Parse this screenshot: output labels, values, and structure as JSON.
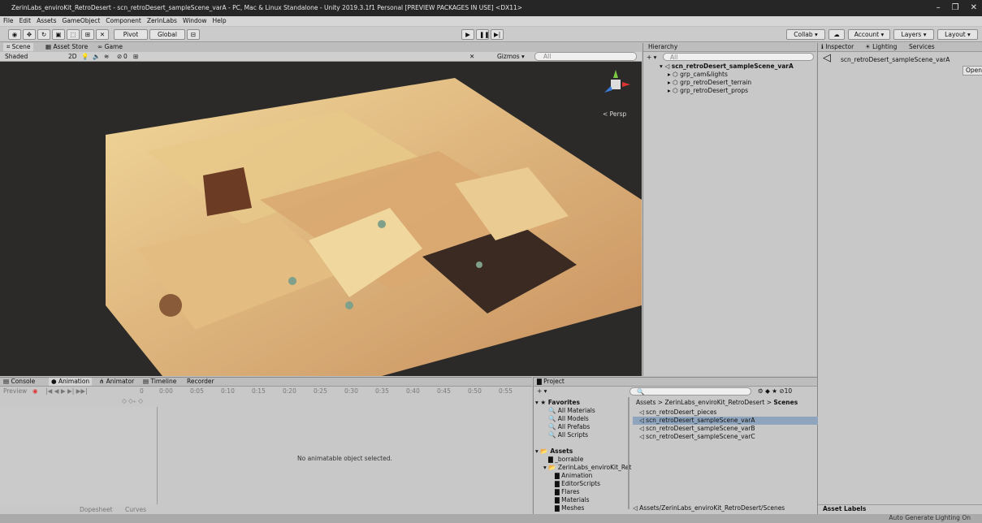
{
  "window": {
    "title": "ZerinLabs_enviroKit_RetroDesert - scn_retroDesert_sampleScene_varA - PC, Mac & Linux Standalone - Unity 2019.3.1f1 Personal [PREVIEW PACKAGES IN USE] <DX11>"
  },
  "menu": [
    "File",
    "Edit",
    "Assets",
    "GameObject",
    "Component",
    "ZerinLabs",
    "Window",
    "Help"
  ],
  "toolbar": {
    "pivot": "Pivot",
    "global": "Global",
    "collab": "Collab ▾",
    "account": "Account ▾",
    "layers": "Layers ▾",
    "layout": "Layout ▾"
  },
  "scene": {
    "tab_scene": "Scene",
    "tab_store": "Asset Store",
    "tab_game": "Game",
    "shading": "Shaded",
    "mode2d": "2D",
    "gizmos": "Gizmos ▾",
    "search": "All",
    "persp": "< Persp",
    "fx_count": "0"
  },
  "hierarchy": {
    "title": "Hierarchy",
    "search": "All",
    "root": "scn_retroDesert_sampleScene_varA",
    "items": [
      "grp_cam&lights",
      "grp_retroDesert_terrain",
      "grp_retroDesert_props"
    ]
  },
  "inspector": {
    "tabs": [
      "Inspector",
      "Lighting",
      "Services"
    ],
    "object": "scn_retroDesert_sampleScene_varA",
    "open": "Open",
    "asset_labels": "Asset Labels"
  },
  "animation": {
    "tabs": [
      "Console",
      "Animation",
      "Animator",
      "Timeline",
      "Recorder"
    ],
    "preview": "Preview",
    "frame": "0",
    "ticks": [
      "0:00",
      "0:05",
      "0:10",
      "0:15",
      "0:20",
      "0:25",
      "0:30",
      "0:35",
      "0:40",
      "0:45",
      "0:50",
      "0:55"
    ],
    "empty": "No animatable object selected.",
    "dopesheet": "Dopesheet",
    "curves": "Curves"
  },
  "project": {
    "title": "Project",
    "hidden_count": "10",
    "favorites": "Favorites",
    "fav_items": [
      "All Materials",
      "All Models",
      "All Prefabs",
      "All Scripts"
    ],
    "assets": "Assets",
    "folders": [
      "_borrable",
      "ZerinLabs_enviroKit_Ret",
      "Animation",
      "EditorScripts",
      "Flares",
      "Materials",
      "Meshes"
    ],
    "breadcrumb": [
      "Assets",
      "ZerinLabs_enviroKit_RetroDesert",
      "Scenes"
    ],
    "files": [
      "scn_retroDesert_pieces",
      "scn_retroDesert_sampleScene_varA",
      "scn_retroDesert_sampleScene_varB",
      "scn_retroDesert_sampleScene_varC"
    ],
    "path": "Assets/ZerinLabs_enviroKit_RetroDesert/Scenes"
  },
  "status": {
    "right": "Auto Generate Lighting On"
  }
}
